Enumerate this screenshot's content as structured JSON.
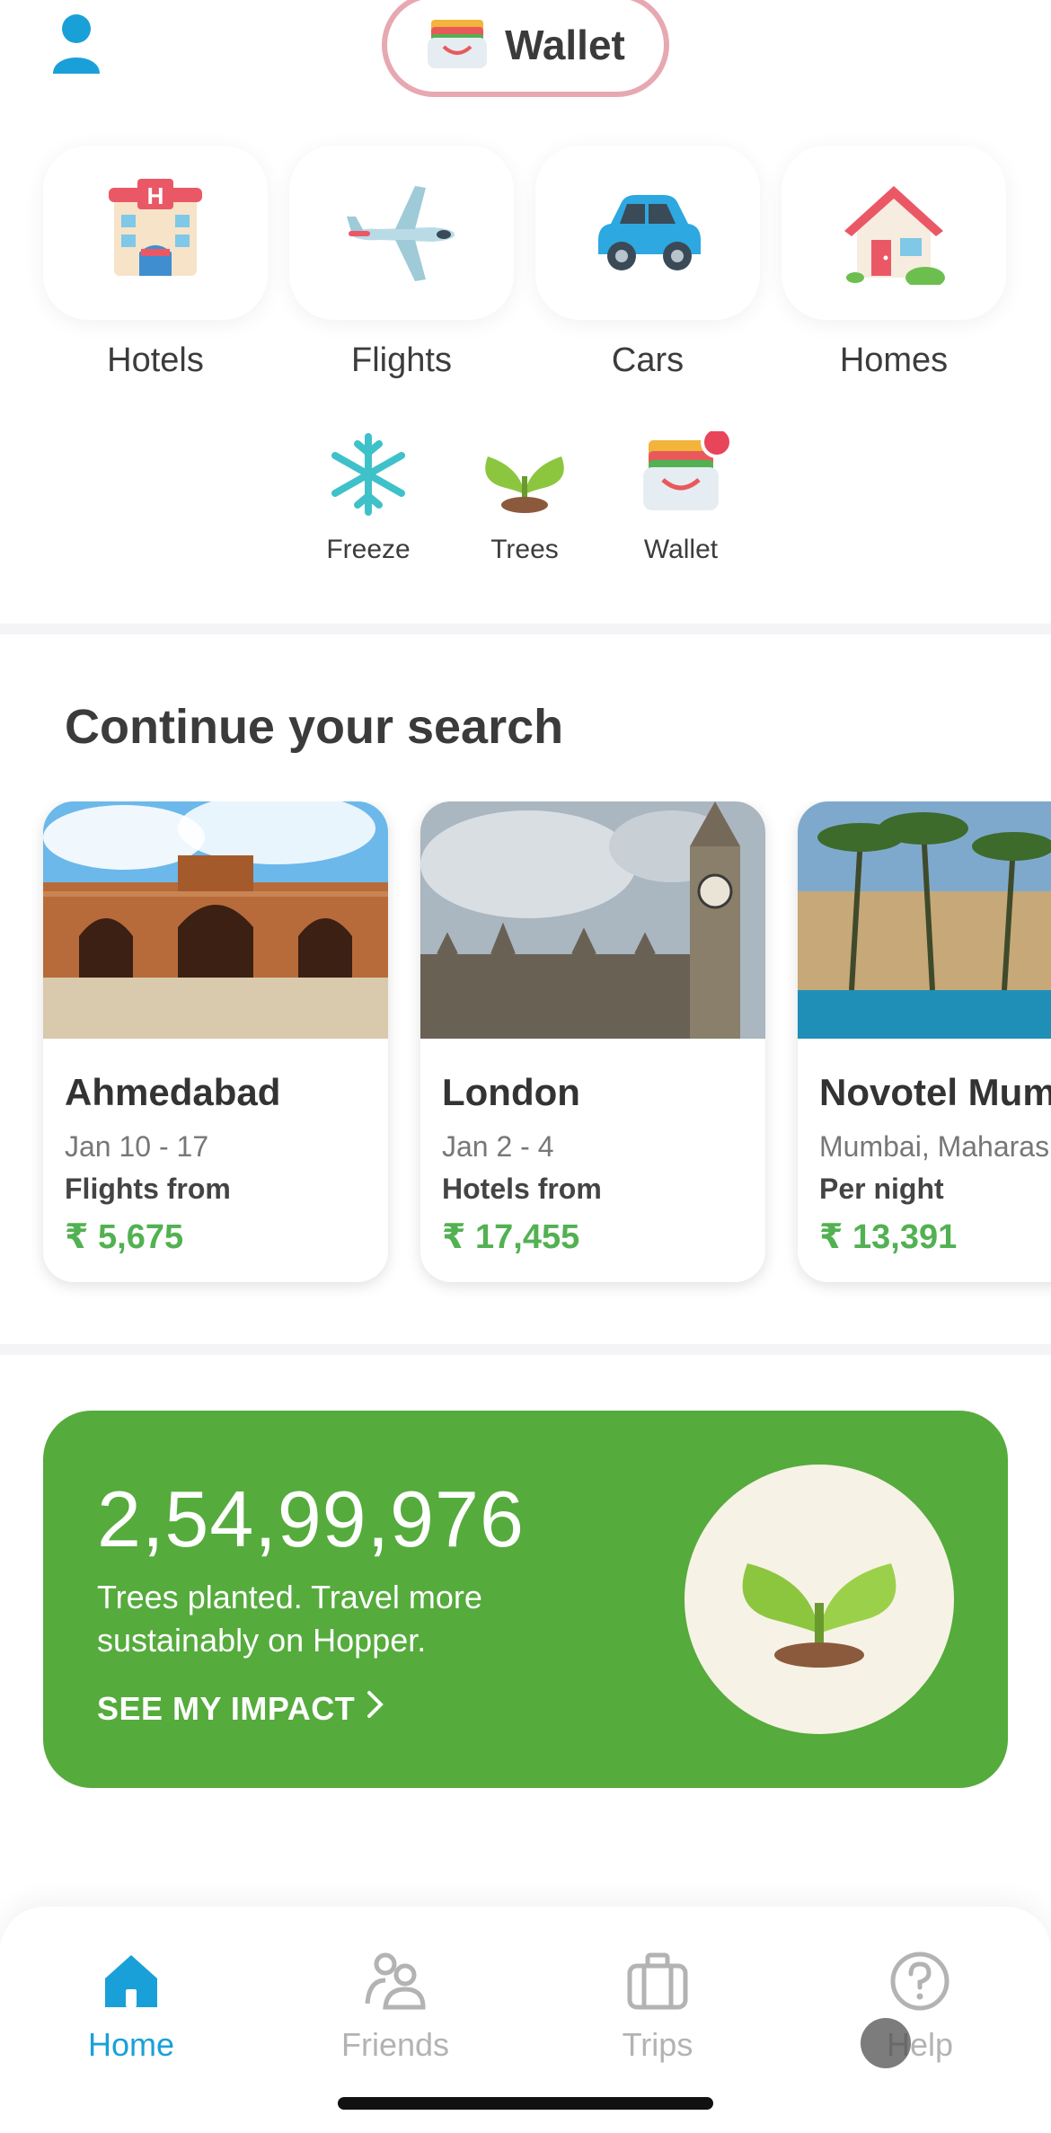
{
  "header": {
    "wallet_label": "Wallet"
  },
  "categories": [
    {
      "label": "Hotels",
      "icon": "hotel-icon"
    },
    {
      "label": "Flights",
      "icon": "airplane-icon"
    },
    {
      "label": "Cars",
      "icon": "car-icon"
    },
    {
      "label": "Homes",
      "icon": "house-icon"
    }
  ],
  "quick_actions": [
    {
      "label": "Freeze",
      "icon": "snowflake-icon"
    },
    {
      "label": "Trees",
      "icon": "sprout-icon"
    },
    {
      "label": "Wallet",
      "icon": "wallet-icon"
    }
  ],
  "continue_search": {
    "title": "Continue your search",
    "cards": [
      {
        "title": "Ahmedabad",
        "sub": "Jan 10 -  17",
        "kind": "Flights from",
        "price": "₹ 5,675"
      },
      {
        "title": "London",
        "sub": "Jan 2 -  4",
        "kind": "Hotels from",
        "price": "₹ 17,455"
      },
      {
        "title": "Novotel Mumbai",
        "sub": "Mumbai, Maharashtra",
        "kind": "Per night",
        "price": "₹ 13,391"
      }
    ]
  },
  "impact": {
    "count": "2,54,99,976",
    "desc": "Trees planted. Travel more sustainably on Hopper.",
    "cta": "SEE MY IMPACT"
  },
  "bottom_nav": {
    "items": [
      {
        "label": "Home",
        "active": true
      },
      {
        "label": "Friends",
        "active": false
      },
      {
        "label": "Trips",
        "active": false
      },
      {
        "label": "Help",
        "active": false
      }
    ]
  },
  "colors": {
    "accent_blue": "#1aa0d8",
    "price_green": "#52b152",
    "impact_green": "#55ab3c",
    "wallet_border": "#e7a8b1"
  }
}
